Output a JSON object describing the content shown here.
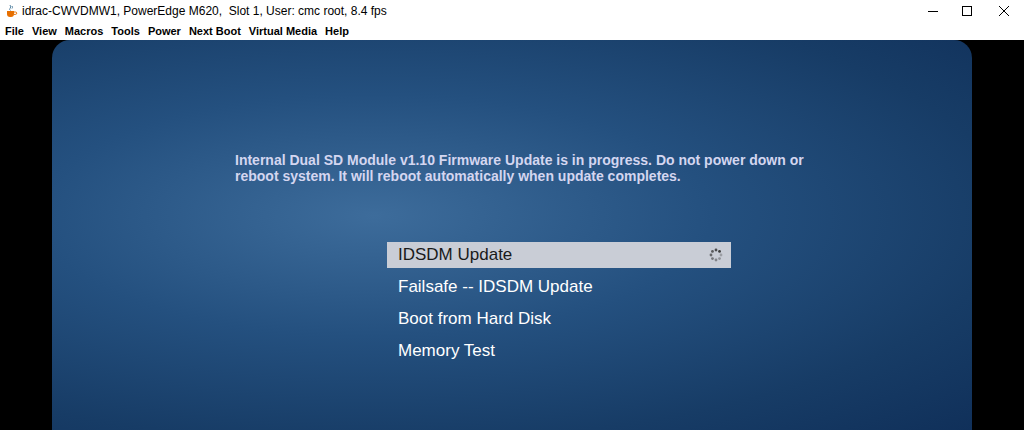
{
  "window": {
    "title": "idrac-CWVDMW1, PowerEdge M620,  Slot 1, User: cmc root, 8.4 fps"
  },
  "menu": [
    "File",
    "View",
    "Macros",
    "Tools",
    "Power",
    "Next Boot",
    "Virtual Media",
    "Help"
  ],
  "message": "Internal Dual SD Module v1.10 Firmware Update is in progress.  Do not power down or reboot system.  It will reboot automatically when update completes.",
  "boot_menu": [
    {
      "label": "IDSDM Update",
      "selected": true,
      "busy": true
    },
    {
      "label": "Failsafe -- IDSDM Update",
      "selected": false,
      "busy": false
    },
    {
      "label": "Boot from Hard Disk",
      "selected": false,
      "busy": false
    },
    {
      "label": "Memory Test",
      "selected": false,
      "busy": false
    }
  ]
}
